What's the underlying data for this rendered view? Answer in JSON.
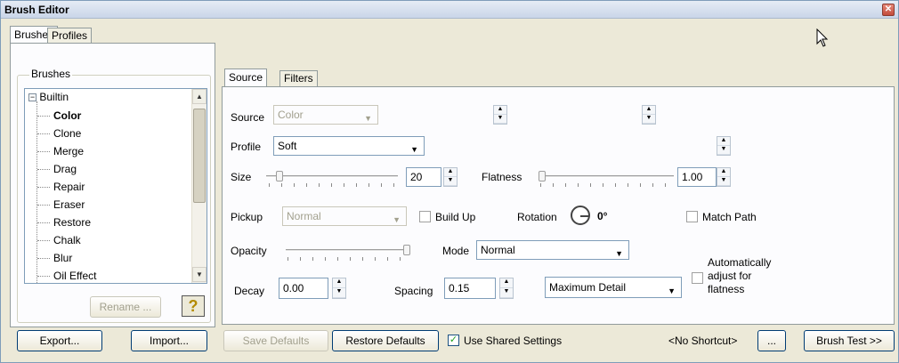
{
  "window": {
    "title": "Brush Editor",
    "close_glyph": "✕"
  },
  "left_tabs": [
    "Brushes",
    "Profiles"
  ],
  "brushes_group": {
    "legend": "Brushes",
    "root": "Builtin",
    "items": [
      "Color",
      "Clone",
      "Merge",
      "Drag",
      "Repair",
      "Eraser",
      "Restore",
      "Chalk",
      "Blur",
      "Oil Effect"
    ],
    "selected": "Color",
    "rename_label": "Rename ...",
    "help_glyph": "?"
  },
  "footer_left": {
    "export_label": "Export...",
    "import_label": "Import..."
  },
  "right_tabs": [
    "Source",
    "Filters"
  ],
  "source": {
    "source_label": "Source",
    "source_value": "Color",
    "profile_label": "Profile",
    "profile_value": "Soft",
    "size_label": "Size",
    "size_value": "20",
    "size_fraction": 0.08,
    "flatness_label": "Flatness",
    "flatness_value": "1.00",
    "flatness_fraction": 0.0,
    "pickup_label": "Pickup",
    "pickup_value": "Normal",
    "buildup_label": "Build Up",
    "buildup_checked": false,
    "rotation_label": "Rotation",
    "rotation_value": "0°",
    "matchpath_label": "Match Path",
    "matchpath_checked": false,
    "opacity_label": "Opacity",
    "opacity_fraction": 1.0,
    "mode_label": "Mode",
    "mode_value": "Normal",
    "decay_label": "Decay",
    "decay_value": "0.00",
    "spacing_label": "Spacing",
    "spacing_value": "0.15",
    "detail_value": "Maximum Detail",
    "autoadjust_label_1": "Automatically",
    "autoadjust_label_2": "adjust for",
    "autoadjust_label_3": "flatness",
    "autoadjust_checked": false
  },
  "footer_right": {
    "save_defaults_label": "Save Defaults",
    "restore_defaults_label": "Restore Defaults",
    "shared_settings_label": "Use Shared Settings",
    "shared_settings_checked": true,
    "shortcut_label": "<No Shortcut>",
    "ellipsis_label": "...",
    "brush_test_label": "Brush Test >>"
  },
  "icons": {
    "cursor": "cursor-arrow-icon",
    "help": "help-question-icon"
  }
}
